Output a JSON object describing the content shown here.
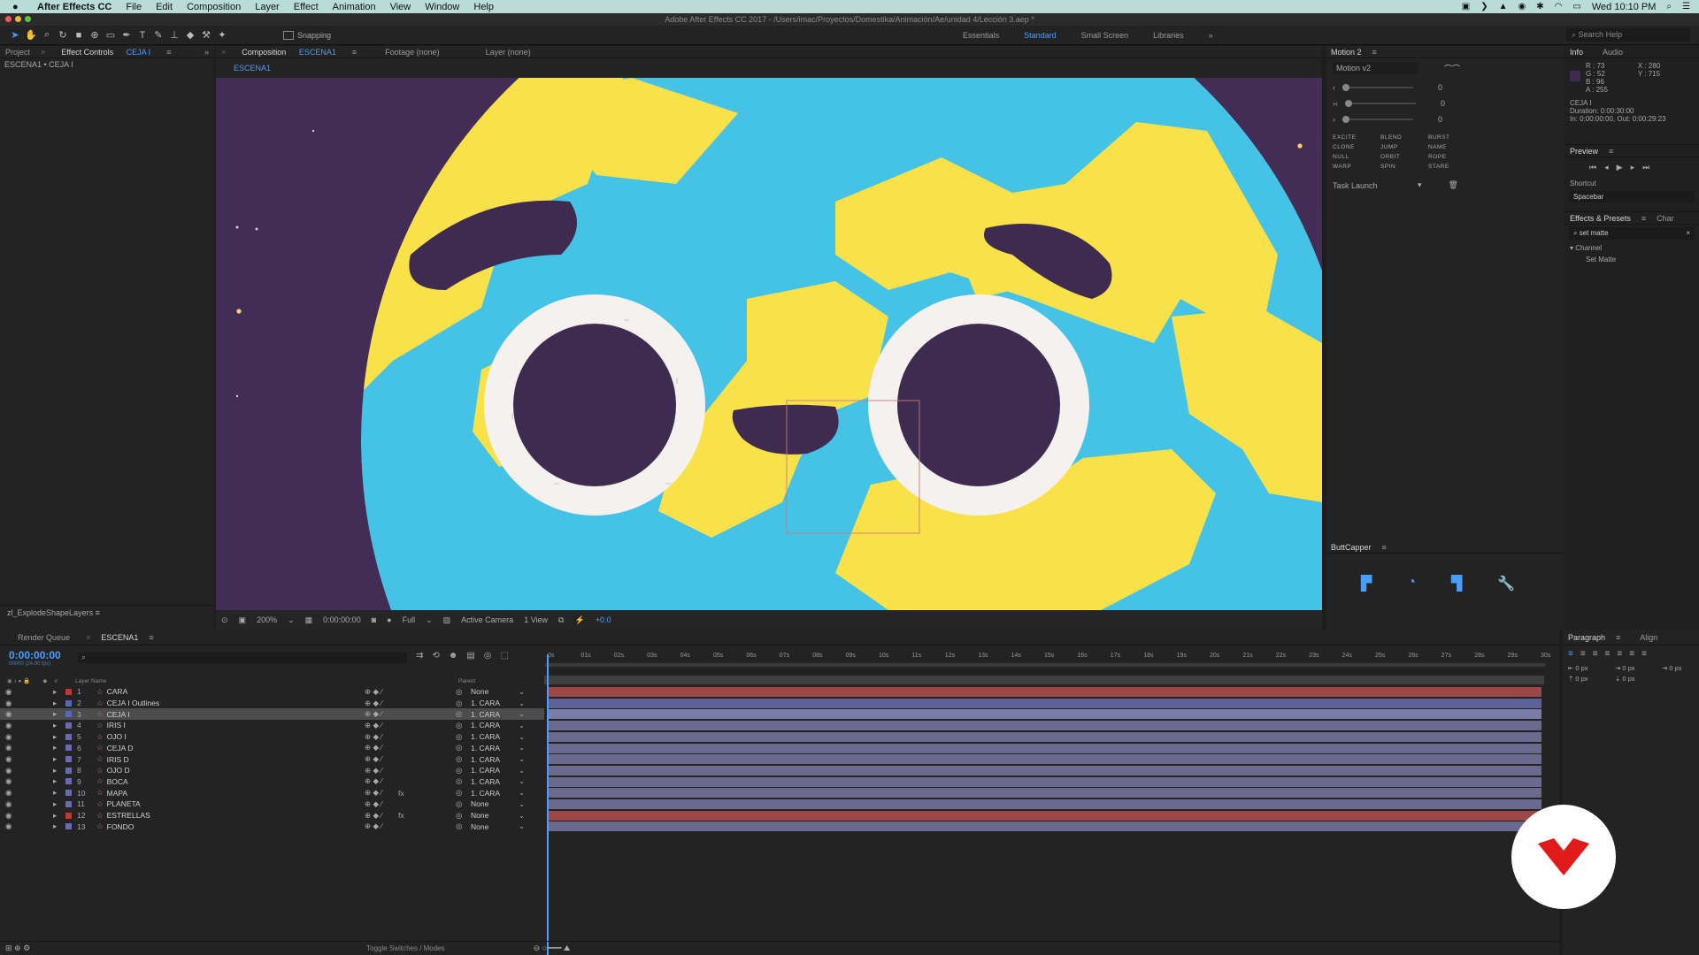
{
  "menubar": {
    "app_name": "After Effects CC",
    "items": [
      "File",
      "Edit",
      "Composition",
      "Layer",
      "Effect",
      "Animation",
      "View",
      "Window",
      "Help"
    ],
    "clock": "Wed 10:10 PM"
  },
  "titlebar": {
    "title": "Adobe After Effects CC 2017 - /Users/imac/Proyectos/Domestika/Animación/Ae/unidad 4/Lección 3.aep *"
  },
  "toolbar": {
    "snapping_label": "Snapping",
    "workspaces": [
      "Essentials",
      "Standard",
      "Small Screen",
      "Libraries"
    ],
    "active_workspace": "Standard",
    "search_help_placeholder": "Search Help"
  },
  "project_panel": {
    "tab_project": "Project",
    "tab_effect_controls": "Effect Controls",
    "effect_controls_layer": "CEJA I",
    "breadcrumb": "ESCENA1 • CEJA I",
    "bottom_label": "zl_ExplodeShapeLayers"
  },
  "viewer": {
    "tab_composition": "Composition",
    "composition_name": "ESCENA1",
    "tab_footage": "Footage (none)",
    "tab_layer": "Layer (none)",
    "subtab": "ESCENA1",
    "zoom": "200%",
    "timecode": "0:00:00:00",
    "resolution": "Full",
    "camera": "Active Camera",
    "views": "1 View",
    "exposure": "+0.0",
    "colors": {
      "ocean": "#45c3e6",
      "land": "#f9e14a",
      "background": "#432c56",
      "eye_white": "#f4f1ee",
      "pupil": "#3f2a50"
    }
  },
  "motion_panel": {
    "title": "Motion 2",
    "preset": "Motion v2",
    "slider_values": [
      "0",
      "0",
      "0"
    ],
    "tools": [
      "EXCITE",
      "BLEND",
      "BURST",
      "CLONE",
      "JUMP",
      "NAME",
      "NULL",
      "ORBIT",
      "ROPE",
      "WARP",
      "SPIN",
      "STARE"
    ],
    "task_launch": "Task Launch"
  },
  "buttcapper": {
    "title": "ButtCapper"
  },
  "info_panel": {
    "tab_info": "Info",
    "tab_audio": "Audio",
    "r": "R : 73",
    "g": "G : 52",
    "b": "B : 96",
    "a": "A : 255",
    "x": "X : 280",
    "y": "Y : 715",
    "layer_name": "CEJA I",
    "duration": "Duration: 0:00:30:00",
    "in_out": "In: 0:00:00:00, Out: 0:00:29:23",
    "preview_title": "Preview",
    "shortcut_label": "Shortcut",
    "shortcut_value": "Spacebar",
    "effects_tab": "Effects & Presets",
    "char_tab": "Char",
    "effects_search": "set matte",
    "category": "▾ Channel",
    "effect_item": "Set Matte"
  },
  "timeline": {
    "tab_render_queue": "Render Queue",
    "tab_comp": "ESCENA1",
    "timecode": "0:00:00:00",
    "frame_info": "00000 (24.00 fps)",
    "col_layer_name": "Layer Name",
    "col_parent": "Parent",
    "ruler_marks": [
      "0s",
      "01s",
      "02s",
      "03s",
      "04s",
      "05s",
      "06s",
      "07s",
      "08s",
      "09s",
      "10s",
      "11s",
      "12s",
      "13s",
      "14s",
      "15s",
      "16s",
      "17s",
      "18s",
      "19s",
      "20s",
      "21s",
      "22s",
      "23s",
      "24s",
      "25s",
      "26s",
      "27s",
      "28s",
      "29s",
      "30s"
    ],
    "layers": [
      {
        "num": "1",
        "name": "CARA",
        "parent": "None",
        "label": "#b83a3a",
        "bar": "#9c4848",
        "fx": ""
      },
      {
        "num": "2",
        "name": "CEJA I Outlines",
        "parent": "1. CARA",
        "label": "#5a66b8",
        "bar": "#5c6296",
        "fx": ""
      },
      {
        "num": "3",
        "name": "CEJA I",
        "parent": "1. CARA",
        "label": "#5a66b8",
        "bar": "#7a7caa",
        "fx": ""
      },
      {
        "num": "4",
        "name": "IRIS I",
        "parent": "1. CARA",
        "label": "#6a6ab0",
        "bar": "#6a6a8e",
        "fx": ""
      },
      {
        "num": "5",
        "name": "OJO I",
        "parent": "1. CARA",
        "label": "#6a6ab0",
        "bar": "#6a6a8e",
        "fx": ""
      },
      {
        "num": "6",
        "name": "CEJA D",
        "parent": "1. CARA",
        "label": "#6a6ab0",
        "bar": "#6a6a8e",
        "fx": ""
      },
      {
        "num": "7",
        "name": "IRIS D",
        "parent": "1. CARA",
        "label": "#6a6ab0",
        "bar": "#6a6a8e",
        "fx": ""
      },
      {
        "num": "8",
        "name": "OJO D",
        "parent": "1. CARA",
        "label": "#6a6ab0",
        "bar": "#6a6a8e",
        "fx": ""
      },
      {
        "num": "9",
        "name": "BOCA",
        "parent": "1. CARA",
        "label": "#6a6ab0",
        "bar": "#6a6a8e",
        "fx": ""
      },
      {
        "num": "10",
        "name": "MAPA",
        "parent": "1. CARA",
        "label": "#6a6ab0",
        "bar": "#6a6a8e",
        "fx": "fx"
      },
      {
        "num": "11",
        "name": "PLANETA",
        "parent": "None",
        "label": "#6a6ab0",
        "bar": "#6a6a8e",
        "fx": ""
      },
      {
        "num": "12",
        "name": "ESTRELLAS",
        "parent": "None",
        "label": "#b83a3a",
        "bar": "#9c4848",
        "fx": "fx"
      },
      {
        "num": "13",
        "name": "FONDO",
        "parent": "None",
        "label": "#6a6ab0",
        "bar": "#6a6a8e",
        "fx": ""
      }
    ],
    "selected_layer": "3",
    "toggle_label": "Toggle Switches / Modes"
  },
  "paragraph_panel": {
    "tab_paragraph": "Paragraph",
    "tab_align": "Align",
    "values": [
      "0 px",
      "0 px",
      "0 px",
      "0 px",
      "0 px"
    ]
  }
}
